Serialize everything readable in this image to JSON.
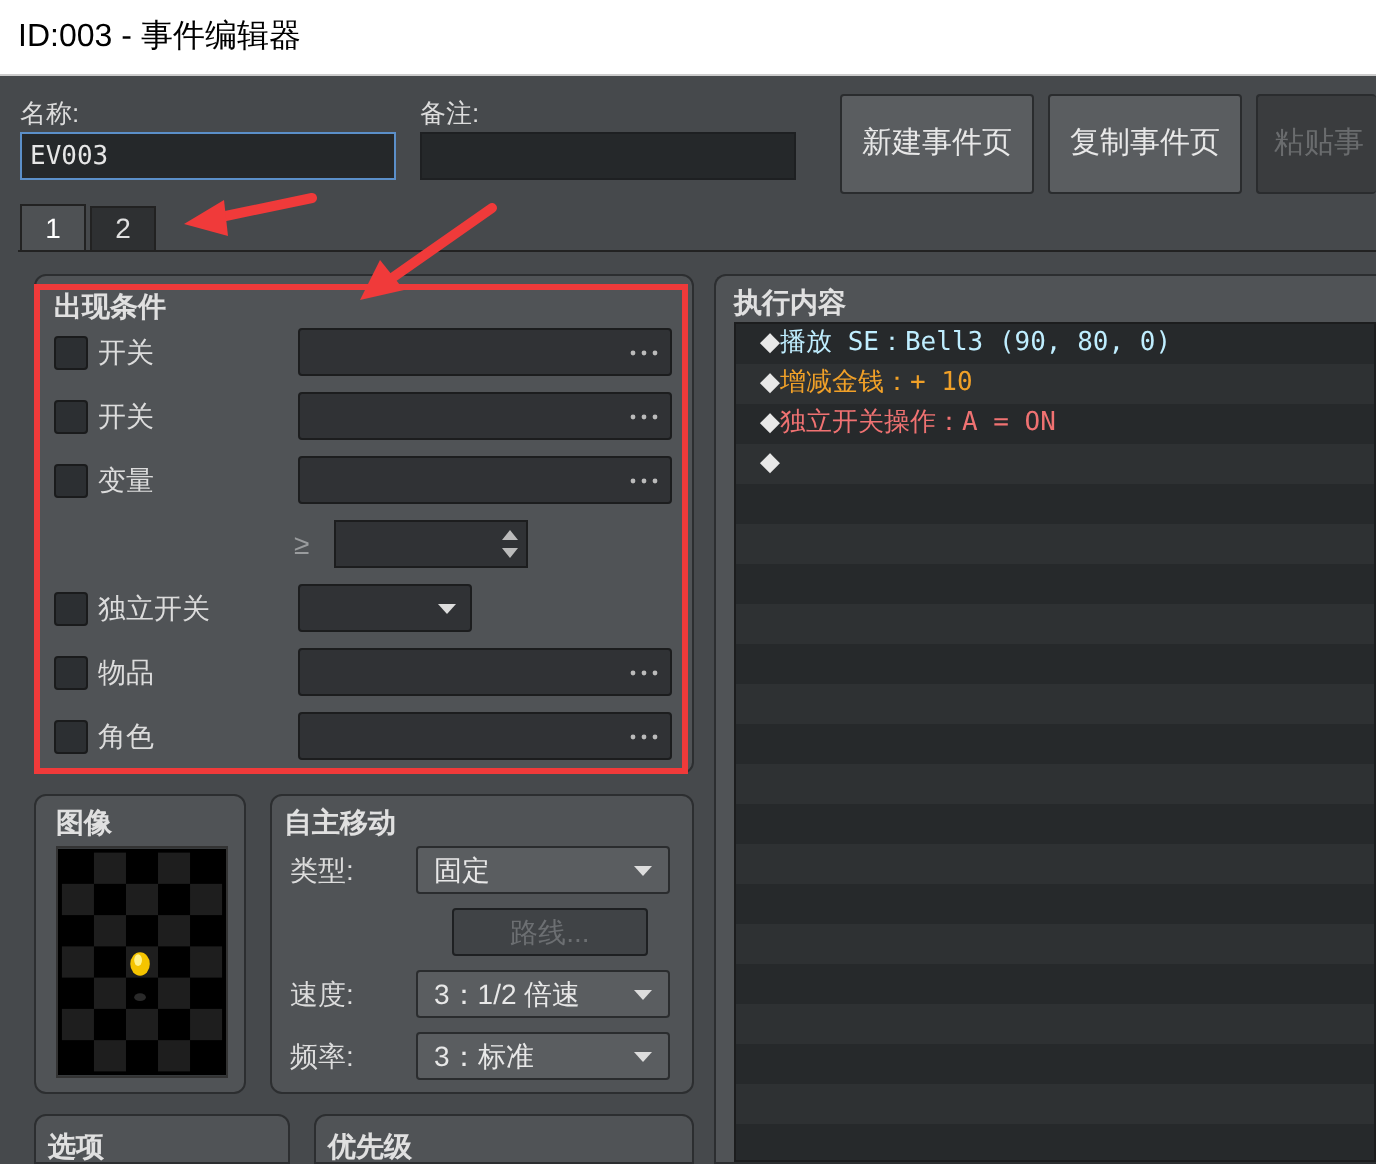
{
  "window": {
    "title": "ID:003 - 事件编辑器"
  },
  "name_field": {
    "label": "名称:",
    "value": "EV003"
  },
  "note_field": {
    "label": "备注:"
  },
  "buttons": [
    {
      "label": "新建事件页",
      "disabled": false
    },
    {
      "label": "复制事件页",
      "disabled": false
    },
    {
      "label": "粘贴事",
      "disabled": true
    }
  ],
  "page_tabs": [
    {
      "label": "1",
      "selected": true
    },
    {
      "label": "2",
      "selected": false
    }
  ],
  "conditions": {
    "title": "出现条件",
    "rows": [
      {
        "kind": "picker",
        "label": "开关",
        "checked": false
      },
      {
        "kind": "picker",
        "label": "开关",
        "checked": false
      },
      {
        "kind": "picker",
        "label": "变量",
        "checked": false
      },
      {
        "kind": "compare",
        "label": "≥"
      },
      {
        "kind": "dropdown",
        "label": "独立开关",
        "checked": false
      },
      {
        "kind": "picker",
        "label": "物品",
        "checked": false
      },
      {
        "kind": "picker",
        "label": "角色",
        "checked": false
      }
    ]
  },
  "contents": {
    "title": "执行内容",
    "commands": [
      {
        "marker": "◆",
        "text": "播放 SE：Bell3 (90, 80, 0)",
        "color": "#bfeeff"
      },
      {
        "marker": "◆",
        "text": "增减金钱：+ 10",
        "color": "#f0a028"
      },
      {
        "marker": "◆",
        "text": "独立开关操作：A = ON",
        "color": "#f07272"
      },
      {
        "marker": "◆"
      }
    ]
  },
  "image": {
    "title": "图像"
  },
  "autonomous_movement": {
    "title": "自主移动",
    "rows": [
      {
        "kind": "dropdown",
        "label": "类型:",
        "value": "固定"
      },
      {
        "kind": "button",
        "label": "路线...",
        "disabled": true
      },
      {
        "kind": "dropdown",
        "label": "速度:",
        "value": "3：1/2 倍速"
      },
      {
        "kind": "dropdown",
        "label": "频率:",
        "value": "3：标准"
      }
    ]
  },
  "options": {
    "title": "选项"
  },
  "priority": {
    "title": "优先级"
  }
}
